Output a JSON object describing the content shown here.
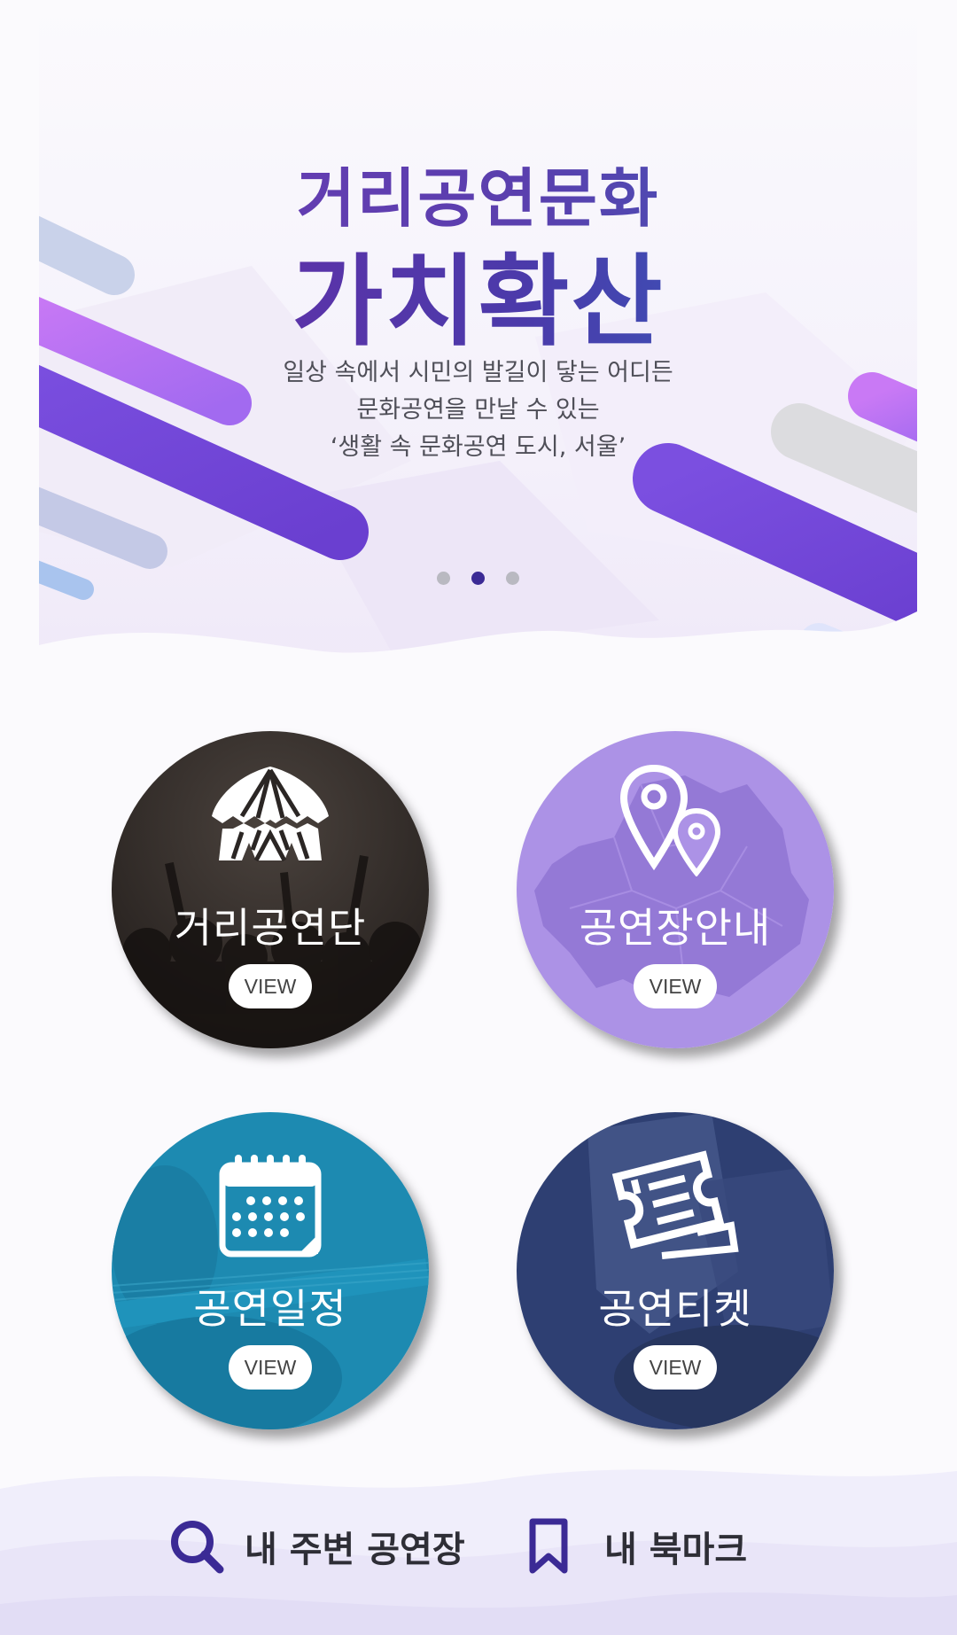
{
  "banner": {
    "title_line1": "거리공연문화",
    "title_line2": "가치확산",
    "description": [
      "일상 속에서 시민의 발길이 닿는 어디든",
      "문화공연을 만날 수 있는",
      "‘생활 속 문화공연 도시, 서울’"
    ],
    "slide_count": 3,
    "active_slide": 2
  },
  "menu": [
    {
      "label": "거리공연단",
      "button": "VIEW",
      "icon": "circus-tent-icon",
      "color": "#2b2624"
    },
    {
      "label": "공연장안내",
      "button": "VIEW",
      "icon": "map-pin-icon",
      "color": "#ac92e6"
    },
    {
      "label": "공연일정",
      "button": "VIEW",
      "icon": "calendar-icon",
      "color": "#1d8ab1"
    },
    {
      "label": "공연티켓",
      "button": "VIEW",
      "icon": "ticket-icon",
      "color": "#2e3f72"
    }
  ],
  "bottom_nav": {
    "nearby": {
      "label": "내 주변 공연장",
      "icon": "search-icon"
    },
    "bookmark": {
      "label": "내 북마크",
      "icon": "bookmark-icon"
    }
  },
  "colors": {
    "accent_purple": "#6b46d6",
    "nav_icon": "#3b2a95",
    "dot_active": "#3b2a95",
    "dot_inactive": "#b9b9c1"
  }
}
